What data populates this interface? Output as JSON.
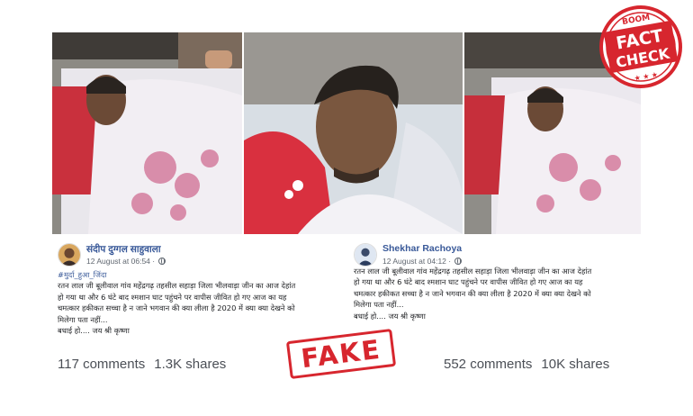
{
  "badge": {
    "top_text": "BOOM",
    "fact_text": "FACT",
    "check_text": "CHECK",
    "stars": "★ ★ ★",
    "color": "#d7262e"
  },
  "stamp": {
    "text": "FAKE",
    "color": "#d7262e"
  },
  "posts": [
    {
      "author": "संदीप दुग्गल साहुवाला",
      "time": "12 August at 06:54",
      "hashtag": "#मुर्दा_हुआ_जिंदा",
      "lines": [
        "रतन लाल जी बूलीवाल गांव महेंद्रगढ़ तहसील सहाड़ा जिला भीलवाड़ा जीन का आज देहांत",
        "हो गया था और 6 घंटे बाद श्मशान घाट पहुंचने पर वापीस जीवित हो गए आज का यह",
        "चमत्कार हकीकत सच्चा है न जाने भगवान की क्या लीला है 2020 में क्या क्या देखने को",
        "मिलेगा पता नहीं...",
        "बधाई हो.... जय श्री कृष्णा"
      ],
      "comments": "117 comments",
      "shares": "1.3K shares"
    },
    {
      "author": "Shekhar Rachoya",
      "time": "12 August at 04:12",
      "lines": [
        "रतन लाल जी बूलीवाल गांव महेंद्रगढ़ तहसील सहाड़ा जिला भीलवाड़ा जीन का आज देहांत",
        "हो गया था और 6 घंटे बाद श्मशान घाट पहुंचने पर वापीस जीवित हो गए आज का यह",
        "चमत्कार हकीकत सच्चा है न जाने भगवान की क्या लीला है 2020 में क्या क्या देखने को",
        "मिलेगा पता नहीं...",
        "बधाई हो.... जय श्री कृष्णा"
      ],
      "comments": "552 comments",
      "shares": "10K shares"
    }
  ]
}
